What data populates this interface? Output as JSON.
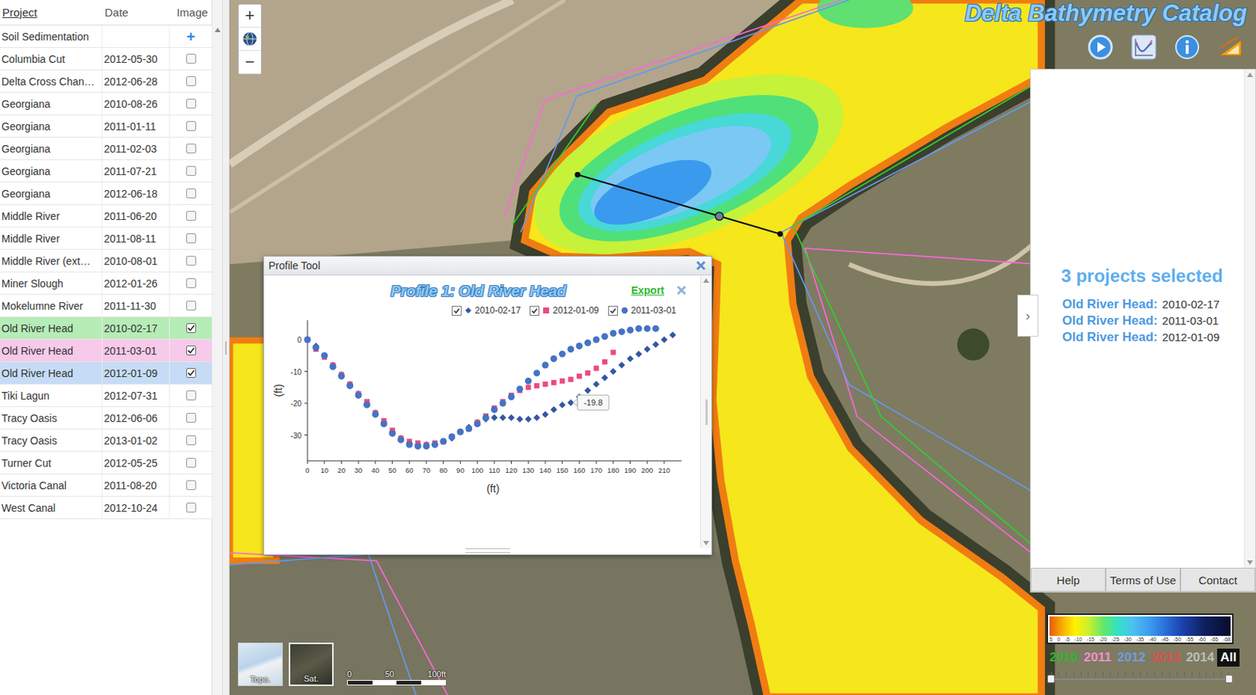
{
  "app": {
    "title": "Delta Bathymetry Catalog"
  },
  "map_controls": {
    "zoom_in": "+",
    "zoom_out": "−"
  },
  "project_table": {
    "columns": [
      "Project",
      "Date",
      "Image"
    ],
    "rows": [
      {
        "kind": "group",
        "name": "Soil Sedimentation",
        "date": "",
        "action": "+"
      },
      {
        "kind": "project",
        "name": "Columbia Cut",
        "date": "2012-05-30",
        "checked": false
      },
      {
        "kind": "project",
        "name": "Delta Cross Chan…",
        "date": "2012-06-28",
        "checked": false
      },
      {
        "kind": "project",
        "name": "Georgiana",
        "date": "2010-08-26",
        "checked": false
      },
      {
        "kind": "project",
        "name": "Georgiana",
        "date": "2011-01-11",
        "checked": false
      },
      {
        "kind": "project",
        "name": "Georgiana",
        "date": "2011-02-03",
        "checked": false
      },
      {
        "kind": "project",
        "name": "Georgiana",
        "date": "2011-07-21",
        "checked": false
      },
      {
        "kind": "project",
        "name": "Georgiana",
        "date": "2012-06-18",
        "checked": false
      },
      {
        "kind": "project",
        "name": "Middle River",
        "date": "2011-06-20",
        "checked": false
      },
      {
        "kind": "project",
        "name": "Middle River",
        "date": "2011-08-11",
        "checked": false
      },
      {
        "kind": "project",
        "name": "Middle River (ext…",
        "date": "2010-08-01",
        "checked": false
      },
      {
        "kind": "project",
        "name": "Miner Slough",
        "date": "2012-01-26",
        "checked": false
      },
      {
        "kind": "project",
        "name": "Mokelumne River",
        "date": "2011-11-30",
        "checked": false
      },
      {
        "kind": "project",
        "name": "Old River Head",
        "date": "2010-02-17",
        "checked": true,
        "color": "#b6ecb6"
      },
      {
        "kind": "project",
        "name": "Old River Head",
        "date": "2011-03-01",
        "checked": true,
        "color": "#f7c9ea"
      },
      {
        "kind": "project",
        "name": "Old River Head",
        "date": "2012-01-09",
        "checked": true,
        "color": "#c6dcf6"
      },
      {
        "kind": "project",
        "name": "Tiki Lagun",
        "date": "2012-07-31",
        "checked": false
      },
      {
        "kind": "project",
        "name": "Tracy Oasis",
        "date": "2012-06-06",
        "checked": false
      },
      {
        "kind": "project",
        "name": "Tracy Oasis",
        "date": "2013-01-02",
        "checked": false
      },
      {
        "kind": "project",
        "name": "Turner Cut",
        "date": "2012-05-25",
        "checked": false
      },
      {
        "kind": "project",
        "name": "Victoria Canal",
        "date": "2011-08-20",
        "checked": false
      },
      {
        "kind": "project",
        "name": "West Canal",
        "date": "2012-10-24",
        "checked": false
      }
    ]
  },
  "profile_tool": {
    "title": "Profile Tool",
    "chart": {
      "title": "Profile 1: Old River Head",
      "export": "Export",
      "x_label": "(ft)",
      "y_label": "(ft)",
      "x_ticks": [
        "0",
        "10",
        "20",
        "30",
        "40",
        "50",
        "60",
        "70",
        "80",
        "90",
        "100",
        "110",
        "120",
        "130",
        "140",
        "150",
        "160",
        "170",
        "180",
        "190",
        "200",
        "210"
      ],
      "y_ticks": [
        "0",
        "-10",
        "-20",
        "-30"
      ],
      "x_step": 5,
      "series": [
        {
          "name": "2010-02-17",
          "kind": "diamond",
          "checked": true,
          "color": "#3456a4",
          "values": [
            0,
            -2,
            -5,
            -8,
            -11,
            -14,
            -17,
            -20,
            -23,
            -26,
            -29,
            -31,
            -32.5,
            -33,
            -33,
            -33,
            -32,
            -31,
            -29,
            -27.5,
            -26,
            -25,
            -24.5,
            -24.5,
            -24.5,
            -25,
            -25,
            -24.5,
            -23.5,
            -22,
            -20.5,
            -19.8,
            -18,
            -16,
            -14,
            -12,
            -10,
            -8,
            -6,
            -4.5,
            -3,
            -1.5,
            0,
            1.5
          ]
        },
        {
          "name": "2012-01-09",
          "kind": "square",
          "checked": true,
          "color": "#ec4a7c",
          "values": [
            0,
            -3,
            -5.5,
            -8,
            -11,
            -14,
            -17,
            -19.5,
            -23,
            -25.5,
            -28.5,
            -31,
            -32,
            -32.5,
            -33,
            -32.5,
            -32,
            -30.5,
            -29,
            -28,
            -26,
            -24,
            -21.5,
            -19.5,
            -17.5,
            -16,
            -15,
            -14.5,
            -14,
            -13.5,
            -13,
            -12.5,
            -11.5,
            -10.5,
            -9,
            -7,
            -4
          ]
        },
        {
          "name": "2011-03-01",
          "kind": "circle",
          "checked": true,
          "color": "#4573c5",
          "values": [
            0,
            -2.5,
            -5,
            -8.5,
            -11.5,
            -14.5,
            -17.5,
            -20.5,
            -23.5,
            -26.5,
            -29.5,
            -31.5,
            -33,
            -33.5,
            -33.5,
            -33,
            -32,
            -30.5,
            -29,
            -28,
            -26.5,
            -24.5,
            -22,
            -20,
            -18,
            -15.5,
            -13,
            -10.5,
            -8,
            -6,
            -4.5,
            -3,
            -2,
            -1,
            0,
            1,
            2,
            2.5,
            3,
            3.5,
            3.5,
            3.5
          ]
        }
      ],
      "tooltip": {
        "series": 0,
        "index": 31,
        "text": "-19.8"
      }
    }
  },
  "selection_panel": {
    "heading": "3 projects selected",
    "toggle": "›",
    "items": [
      {
        "name": "Old River Head:",
        "date": "2010-02-17"
      },
      {
        "name": "Old River Head:",
        "date": "2011-03-01"
      },
      {
        "name": "Old River Head:",
        "date": "2012-01-09"
      }
    ],
    "footer_buttons": [
      "Help",
      "Terms of Use",
      "Contact"
    ]
  },
  "depth_legend": {
    "ticks": [
      "5",
      "0",
      "-5",
      "-10",
      "-15",
      "-20",
      "-25",
      "-30",
      "-35",
      "-40",
      "-45",
      "-50",
      "-55",
      "-60",
      "-65",
      "-68"
    ]
  },
  "time_filter": {
    "years": [
      {
        "label": "2010",
        "color": "#2cb82c",
        "selected": false
      },
      {
        "label": "2011",
        "color": "#f58fd3",
        "selected": false
      },
      {
        "label": "2012",
        "color": "#6b9fe0",
        "selected": false
      },
      {
        "label": "2013",
        "color": "#e84a4a",
        "selected": false
      },
      {
        "label": "2014",
        "color": "#bdbdbd",
        "selected": false
      },
      {
        "label": "All",
        "color": "#111111",
        "selected": true
      }
    ],
    "slider": {
      "low": 0,
      "high": 1
    }
  },
  "basemaps": [
    {
      "label": "Topo.",
      "selected": false
    },
    {
      "label": "Sat.",
      "selected": true
    }
  ],
  "scale_bar": {
    "labels": [
      "0",
      "50",
      "100ft"
    ]
  }
}
